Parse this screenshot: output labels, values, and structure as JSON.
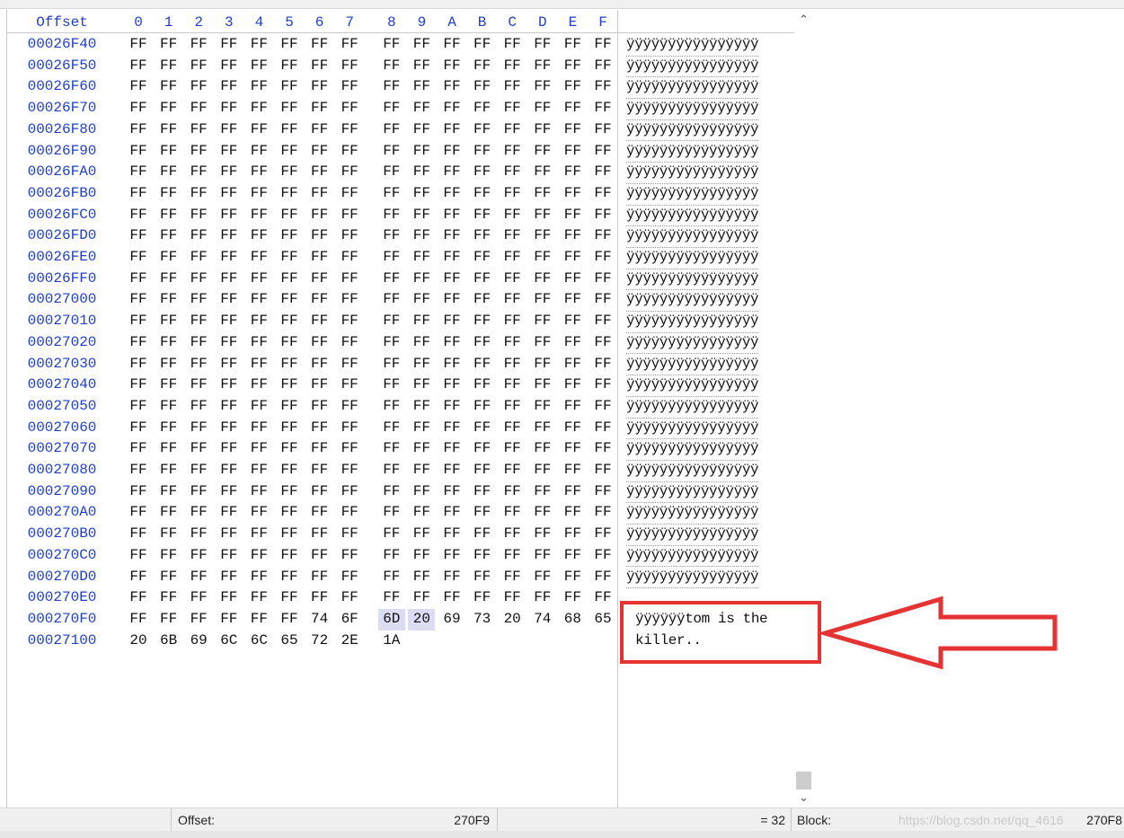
{
  "header": {
    "offset_label": "Offset",
    "columns": [
      "0",
      "1",
      "2",
      "3",
      "4",
      "5",
      "6",
      "7",
      "8",
      "9",
      "A",
      "B",
      "C",
      "D",
      "E",
      "F"
    ]
  },
  "rows": [
    {
      "offset": "00026F40",
      "bytes": [
        "FF",
        "FF",
        "FF",
        "FF",
        "FF",
        "FF",
        "FF",
        "FF",
        "FF",
        "FF",
        "FF",
        "FF",
        "FF",
        "FF",
        "FF",
        "FF"
      ],
      "ascii": "ÿÿÿÿÿÿÿÿÿÿÿÿÿÿÿÿ"
    },
    {
      "offset": "00026F50",
      "bytes": [
        "FF",
        "FF",
        "FF",
        "FF",
        "FF",
        "FF",
        "FF",
        "FF",
        "FF",
        "FF",
        "FF",
        "FF",
        "FF",
        "FF",
        "FF",
        "FF"
      ],
      "ascii": "ÿÿÿÿÿÿÿÿÿÿÿÿÿÿÿÿ"
    },
    {
      "offset": "00026F60",
      "bytes": [
        "FF",
        "FF",
        "FF",
        "FF",
        "FF",
        "FF",
        "FF",
        "FF",
        "FF",
        "FF",
        "FF",
        "FF",
        "FF",
        "FF",
        "FF",
        "FF"
      ],
      "ascii": "ÿÿÿÿÿÿÿÿÿÿÿÿÿÿÿÿ"
    },
    {
      "offset": "00026F70",
      "bytes": [
        "FF",
        "FF",
        "FF",
        "FF",
        "FF",
        "FF",
        "FF",
        "FF",
        "FF",
        "FF",
        "FF",
        "FF",
        "FF",
        "FF",
        "FF",
        "FF"
      ],
      "ascii": "ÿÿÿÿÿÿÿÿÿÿÿÿÿÿÿÿ"
    },
    {
      "offset": "00026F80",
      "bytes": [
        "FF",
        "FF",
        "FF",
        "FF",
        "FF",
        "FF",
        "FF",
        "FF",
        "FF",
        "FF",
        "FF",
        "FF",
        "FF",
        "FF",
        "FF",
        "FF"
      ],
      "ascii": "ÿÿÿÿÿÿÿÿÿÿÿÿÿÿÿÿ"
    },
    {
      "offset": "00026F90",
      "bytes": [
        "FF",
        "FF",
        "FF",
        "FF",
        "FF",
        "FF",
        "FF",
        "FF",
        "FF",
        "FF",
        "FF",
        "FF",
        "FF",
        "FF",
        "FF",
        "FF"
      ],
      "ascii": "ÿÿÿÿÿÿÿÿÿÿÿÿÿÿÿÿ"
    },
    {
      "offset": "00026FA0",
      "bytes": [
        "FF",
        "FF",
        "FF",
        "FF",
        "FF",
        "FF",
        "FF",
        "FF",
        "FF",
        "FF",
        "FF",
        "FF",
        "FF",
        "FF",
        "FF",
        "FF"
      ],
      "ascii": "ÿÿÿÿÿÿÿÿÿÿÿÿÿÿÿÿ"
    },
    {
      "offset": "00026FB0",
      "bytes": [
        "FF",
        "FF",
        "FF",
        "FF",
        "FF",
        "FF",
        "FF",
        "FF",
        "FF",
        "FF",
        "FF",
        "FF",
        "FF",
        "FF",
        "FF",
        "FF"
      ],
      "ascii": "ÿÿÿÿÿÿÿÿÿÿÿÿÿÿÿÿ"
    },
    {
      "offset": "00026FC0",
      "bytes": [
        "FF",
        "FF",
        "FF",
        "FF",
        "FF",
        "FF",
        "FF",
        "FF",
        "FF",
        "FF",
        "FF",
        "FF",
        "FF",
        "FF",
        "FF",
        "FF"
      ],
      "ascii": "ÿÿÿÿÿÿÿÿÿÿÿÿÿÿÿÿ"
    },
    {
      "offset": "00026FD0",
      "bytes": [
        "FF",
        "FF",
        "FF",
        "FF",
        "FF",
        "FF",
        "FF",
        "FF",
        "FF",
        "FF",
        "FF",
        "FF",
        "FF",
        "FF",
        "FF",
        "FF"
      ],
      "ascii": "ÿÿÿÿÿÿÿÿÿÿÿÿÿÿÿÿ"
    },
    {
      "offset": "00026FE0",
      "bytes": [
        "FF",
        "FF",
        "FF",
        "FF",
        "FF",
        "FF",
        "FF",
        "FF",
        "FF",
        "FF",
        "FF",
        "FF",
        "FF",
        "FF",
        "FF",
        "FF"
      ],
      "ascii": "ÿÿÿÿÿÿÿÿÿÿÿÿÿÿÿÿ"
    },
    {
      "offset": "00026FF0",
      "bytes": [
        "FF",
        "FF",
        "FF",
        "FF",
        "FF",
        "FF",
        "FF",
        "FF",
        "FF",
        "FF",
        "FF",
        "FF",
        "FF",
        "FF",
        "FF",
        "FF"
      ],
      "ascii": "ÿÿÿÿÿÿÿÿÿÿÿÿÿÿÿÿ"
    },
    {
      "offset": "00027000",
      "bytes": [
        "FF",
        "FF",
        "FF",
        "FF",
        "FF",
        "FF",
        "FF",
        "FF",
        "FF",
        "FF",
        "FF",
        "FF",
        "FF",
        "FF",
        "FF",
        "FF"
      ],
      "ascii": "ÿÿÿÿÿÿÿÿÿÿÿÿÿÿÿÿ"
    },
    {
      "offset": "00027010",
      "bytes": [
        "FF",
        "FF",
        "FF",
        "FF",
        "FF",
        "FF",
        "FF",
        "FF",
        "FF",
        "FF",
        "FF",
        "FF",
        "FF",
        "FF",
        "FF",
        "FF"
      ],
      "ascii": "ÿÿÿÿÿÿÿÿÿÿÿÿÿÿÿÿ"
    },
    {
      "offset": "00027020",
      "bytes": [
        "FF",
        "FF",
        "FF",
        "FF",
        "FF",
        "FF",
        "FF",
        "FF",
        "FF",
        "FF",
        "FF",
        "FF",
        "FF",
        "FF",
        "FF",
        "FF"
      ],
      "ascii": "ÿÿÿÿÿÿÿÿÿÿÿÿÿÿÿÿ"
    },
    {
      "offset": "00027030",
      "bytes": [
        "FF",
        "FF",
        "FF",
        "FF",
        "FF",
        "FF",
        "FF",
        "FF",
        "FF",
        "FF",
        "FF",
        "FF",
        "FF",
        "FF",
        "FF",
        "FF"
      ],
      "ascii": "ÿÿÿÿÿÿÿÿÿÿÿÿÿÿÿÿ"
    },
    {
      "offset": "00027040",
      "bytes": [
        "FF",
        "FF",
        "FF",
        "FF",
        "FF",
        "FF",
        "FF",
        "FF",
        "FF",
        "FF",
        "FF",
        "FF",
        "FF",
        "FF",
        "FF",
        "FF"
      ],
      "ascii": "ÿÿÿÿÿÿÿÿÿÿÿÿÿÿÿÿ"
    },
    {
      "offset": "00027050",
      "bytes": [
        "FF",
        "FF",
        "FF",
        "FF",
        "FF",
        "FF",
        "FF",
        "FF",
        "FF",
        "FF",
        "FF",
        "FF",
        "FF",
        "FF",
        "FF",
        "FF"
      ],
      "ascii": "ÿÿÿÿÿÿÿÿÿÿÿÿÿÿÿÿ"
    },
    {
      "offset": "00027060",
      "bytes": [
        "FF",
        "FF",
        "FF",
        "FF",
        "FF",
        "FF",
        "FF",
        "FF",
        "FF",
        "FF",
        "FF",
        "FF",
        "FF",
        "FF",
        "FF",
        "FF"
      ],
      "ascii": "ÿÿÿÿÿÿÿÿÿÿÿÿÿÿÿÿ"
    },
    {
      "offset": "00027070",
      "bytes": [
        "FF",
        "FF",
        "FF",
        "FF",
        "FF",
        "FF",
        "FF",
        "FF",
        "FF",
        "FF",
        "FF",
        "FF",
        "FF",
        "FF",
        "FF",
        "FF"
      ],
      "ascii": "ÿÿÿÿÿÿÿÿÿÿÿÿÿÿÿÿ"
    },
    {
      "offset": "00027080",
      "bytes": [
        "FF",
        "FF",
        "FF",
        "FF",
        "FF",
        "FF",
        "FF",
        "FF",
        "FF",
        "FF",
        "FF",
        "FF",
        "FF",
        "FF",
        "FF",
        "FF"
      ],
      "ascii": "ÿÿÿÿÿÿÿÿÿÿÿÿÿÿÿÿ"
    },
    {
      "offset": "00027090",
      "bytes": [
        "FF",
        "FF",
        "FF",
        "FF",
        "FF",
        "FF",
        "FF",
        "FF",
        "FF",
        "FF",
        "FF",
        "FF",
        "FF",
        "FF",
        "FF",
        "FF"
      ],
      "ascii": "ÿÿÿÿÿÿÿÿÿÿÿÿÿÿÿÿ"
    },
    {
      "offset": "000270A0",
      "bytes": [
        "FF",
        "FF",
        "FF",
        "FF",
        "FF",
        "FF",
        "FF",
        "FF",
        "FF",
        "FF",
        "FF",
        "FF",
        "FF",
        "FF",
        "FF",
        "FF"
      ],
      "ascii": "ÿÿÿÿÿÿÿÿÿÿÿÿÿÿÿÿ"
    },
    {
      "offset": "000270B0",
      "bytes": [
        "FF",
        "FF",
        "FF",
        "FF",
        "FF",
        "FF",
        "FF",
        "FF",
        "FF",
        "FF",
        "FF",
        "FF",
        "FF",
        "FF",
        "FF",
        "FF"
      ],
      "ascii": "ÿÿÿÿÿÿÿÿÿÿÿÿÿÿÿÿ"
    },
    {
      "offset": "000270C0",
      "bytes": [
        "FF",
        "FF",
        "FF",
        "FF",
        "FF",
        "FF",
        "FF",
        "FF",
        "FF",
        "FF",
        "FF",
        "FF",
        "FF",
        "FF",
        "FF",
        "FF"
      ],
      "ascii": "ÿÿÿÿÿÿÿÿÿÿÿÿÿÿÿÿ"
    },
    {
      "offset": "000270D0",
      "bytes": [
        "FF",
        "FF",
        "FF",
        "FF",
        "FF",
        "FF",
        "FF",
        "FF",
        "FF",
        "FF",
        "FF",
        "FF",
        "FF",
        "FF",
        "FF",
        "FF"
      ],
      "ascii": "ÿÿÿÿÿÿÿÿÿÿÿÿÿÿÿÿ"
    },
    {
      "offset": "000270E0",
      "bytes": [
        "FF",
        "FF",
        "FF",
        "FF",
        "FF",
        "FF",
        "FF",
        "FF",
        "FF",
        "FF",
        "FF",
        "FF",
        "FF",
        "FF",
        "FF",
        "FF"
      ],
      "ascii": ""
    },
    {
      "offset": "000270F0",
      "bytes": [
        "FF",
        "FF",
        "FF",
        "FF",
        "FF",
        "FF",
        "74",
        "6F",
        "6D",
        "20",
        "69",
        "73",
        "20",
        "74",
        "68",
        "65"
      ],
      "ascii": "ÿÿÿÿÿÿtom is the"
    },
    {
      "offset": "00027100",
      "bytes": [
        "20",
        "6B",
        "69",
        "6C",
        "6C",
        "65",
        "72",
        "2E",
        "1A"
      ],
      "ascii": "killer.."
    }
  ],
  "selection": {
    "row": 27,
    "start": 8,
    "end": 9
  },
  "status": {
    "offset_label": "Offset:",
    "offset_value": "270F9",
    "sel_value": "= 32",
    "block_label": "Block:",
    "block_value": "270F8"
  },
  "watermark": "https://blog.csdn.net/qq_4616",
  "colors": {
    "offset": "#1f3fc9",
    "callout": "#e53232",
    "selection": "#dcdcf5"
  },
  "scrollbar": {
    "position": 0.98
  }
}
